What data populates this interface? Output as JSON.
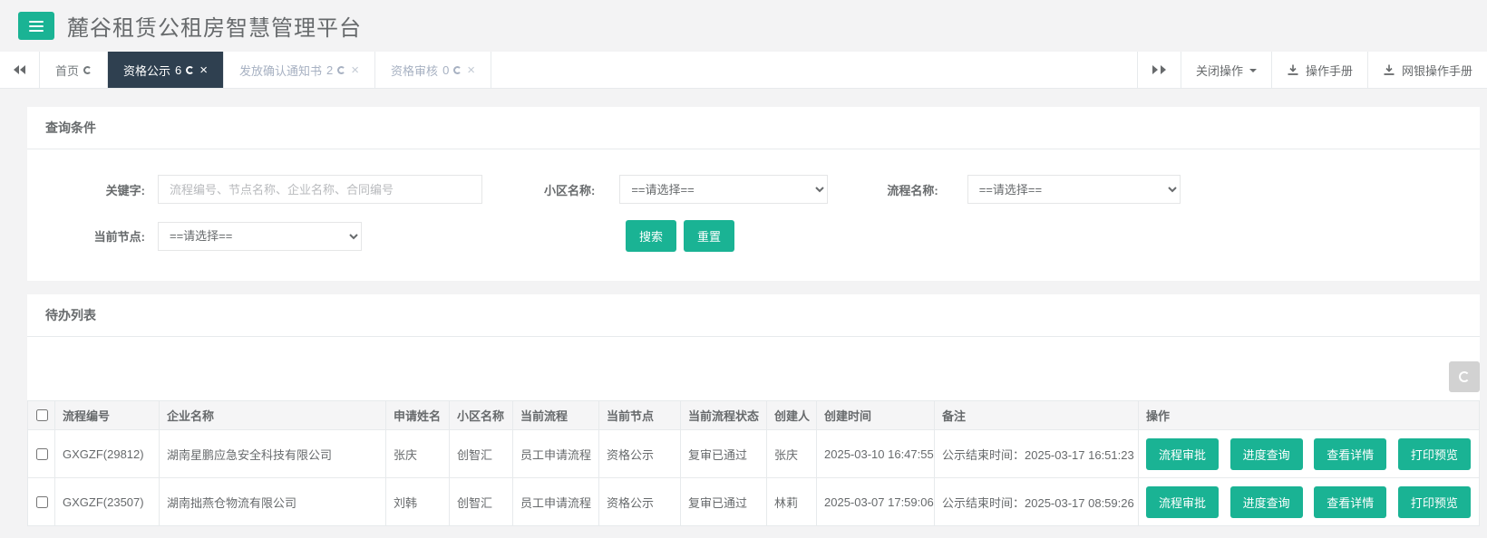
{
  "colors": {
    "accent_green": "#1ab394",
    "tab_active_bg": "#2f4050",
    "text": "#676a6c",
    "border": "#e7eaec",
    "page_bg": "#f3f3f4"
  },
  "icons": {
    "menu": "hamburger",
    "tab_refresh": "refresh-arc",
    "tab_close": "×",
    "collapse_tabs": "double-left-triangles",
    "expand_tabs": "double-right-triangles",
    "dropdown_caret": "triangle-down",
    "download": "arrow-into-tray",
    "table_refresh": "refresh-arc"
  },
  "header": {
    "title": "麓谷租赁公租房智慧管理平台"
  },
  "tabbar": {
    "tabs": [
      {
        "label": "首页",
        "count": ""
      },
      {
        "label": "资格公示",
        "count": "6"
      },
      {
        "label": "发放确认通知书",
        "count": "2"
      },
      {
        "label": "资格审核",
        "count": "0"
      }
    ],
    "close_ops_label": "关闭操作",
    "manual_label": "操作手册",
    "ebank_manual_label": "网银操作手册"
  },
  "query": {
    "panel_title": "查询条件",
    "keyword_label": "关键字:",
    "keyword_placeholder": "流程编号、节点名称、企业名称、合同编号",
    "community_label": "小区名称:",
    "flow_label": "流程名称:",
    "node_label": "当前节点:",
    "select_placeholder": "==请选择==",
    "search_label": "搜索",
    "reset_label": "重置"
  },
  "todo": {
    "panel_title": "待办列表",
    "headers": [
      "流程编号",
      "企业名称",
      "申请姓名",
      "小区名称",
      "当前流程",
      "当前节点",
      "当前流程状态",
      "创建人",
      "创建时间",
      "备注",
      "操作"
    ],
    "action_labels": [
      "流程审批",
      "进度查询",
      "查看详情",
      "打印预览"
    ],
    "rows": [
      {
        "process_no": "GXGZF(29812)",
        "company": "湖南星鹏应急安全科技有限公司",
        "applicant": "张庆",
        "community": "创智汇",
        "flow": "员工申请流程",
        "node": "资格公示",
        "status": "复审已通过",
        "creator": "张庆",
        "created": "2025-03-10 16:47:55",
        "remark": "公示结束时间：2025-03-17 16:51:23"
      },
      {
        "process_no": "GXGZF(23507)",
        "company": "湖南拙燕仓物流有限公司",
        "applicant": "刘韩",
        "community": "创智汇",
        "flow": "员工申请流程",
        "node": "资格公示",
        "status": "复审已通过",
        "creator": "林莉",
        "created": "2025-03-07 17:59:06",
        "remark": "公示结束时间：2025-03-17 08:59:26"
      }
    ]
  }
}
